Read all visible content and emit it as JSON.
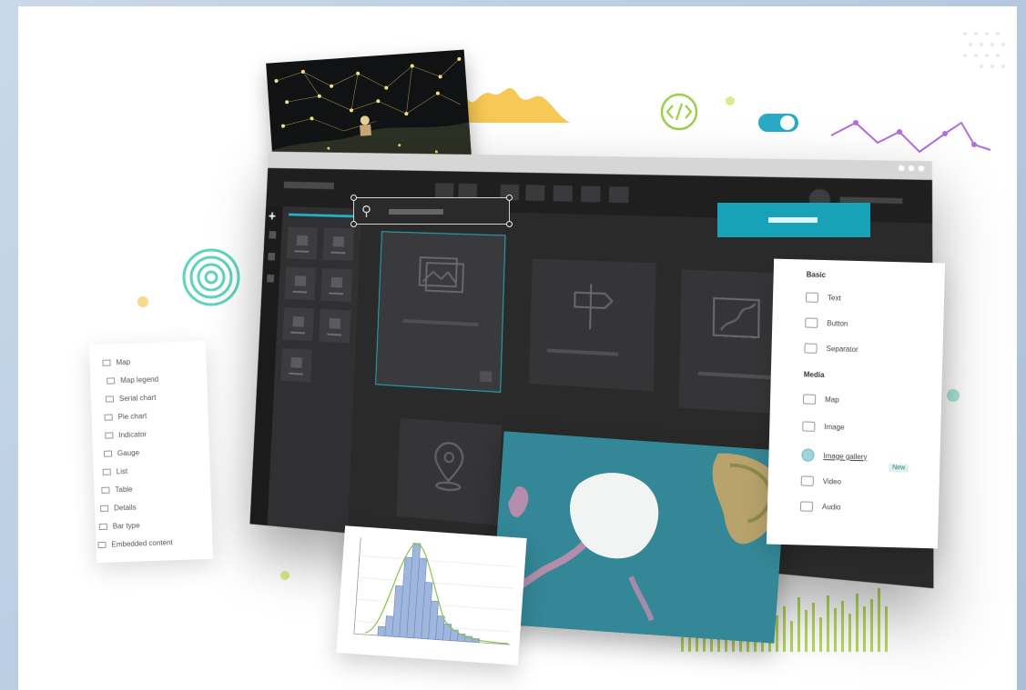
{
  "colors": {
    "accent": "#17a2b8",
    "teal": "#5fd3bf",
    "lime": "#b6d85c",
    "yellow": "#f5c242",
    "purple": "#b26fde",
    "app_dark": "#2a2a2b"
  },
  "icons": {
    "search": "search-icon",
    "code": "code-icon",
    "toggle": "toggle-icon",
    "image": "image-icon",
    "signpost": "signpost-icon",
    "map": "map-icon",
    "location": "location-pin-icon",
    "plus": "plus-icon"
  },
  "widget_list": {
    "items": [
      "Map",
      "Map legend",
      "Serial chart",
      "Pie chart",
      "Indicator",
      "Gauge",
      "List",
      "Table",
      "Details",
      "Bar type",
      "Embedded content"
    ]
  },
  "prop_panel": {
    "basic_heading": "Basic",
    "basic_items": [
      "Text",
      "Button",
      "Separator"
    ],
    "media_heading": "Media",
    "media_items": [
      "Map",
      "Image",
      "Image gallery",
      "Video",
      "Audio"
    ],
    "new_badge": "New"
  },
  "toggle": {
    "on": true
  }
}
